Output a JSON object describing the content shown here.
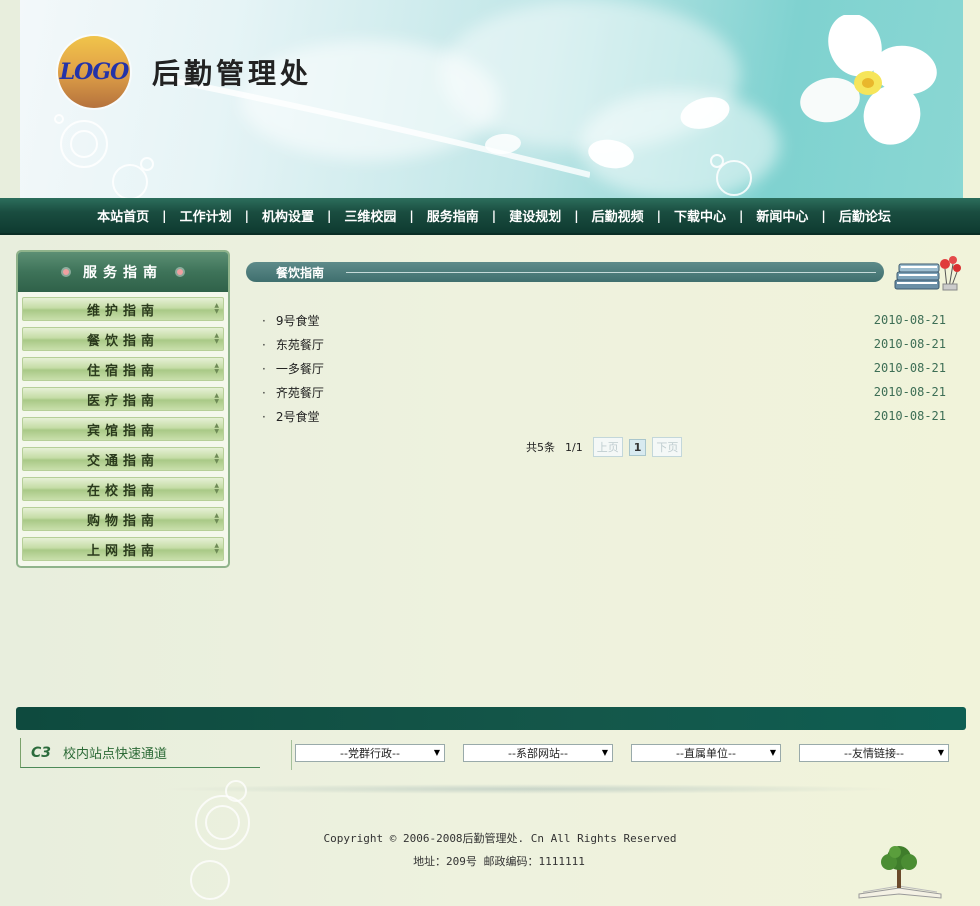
{
  "header": {
    "logo_text": "LOGO",
    "site_title": "后勤管理处"
  },
  "nav": {
    "items": [
      "本站首页",
      "工作计划",
      "机构设置",
      "三维校园",
      "服务指南",
      "建设规划",
      "后勤视频",
      "下载中心",
      "新闻中心",
      "后勤论坛"
    ],
    "separator": "|"
  },
  "sidebar": {
    "title": "服务指南",
    "items": [
      "维护指南",
      "餐饮指南",
      "住宿指南",
      "医疗指南",
      "宾馆指南",
      "交通指南",
      "在校指南",
      "购物指南",
      "上网指南"
    ]
  },
  "main": {
    "section_title": "餐饮指南",
    "articles": [
      {
        "title": "9号食堂",
        "date": "2010-08-21"
      },
      {
        "title": "东苑餐厅",
        "date": "2010-08-21"
      },
      {
        "title": "一多餐厅",
        "date": "2010-08-21"
      },
      {
        "title": "齐苑餐厅",
        "date": "2010-08-21"
      },
      {
        "title": "2号食堂",
        "date": "2010-08-21"
      }
    ],
    "pager": {
      "total": "共5条",
      "pages": "1/1",
      "prev": "上页",
      "current": "1",
      "next": "下页"
    }
  },
  "footer": {
    "quick_icon": "C3",
    "quick_label": "校内站点快速通道",
    "selects": [
      "--党群行政--",
      "--系部网站--",
      "--直属单位--",
      "--友情链接--"
    ],
    "copyright": "Copyright ©  2006-2008后勤管理处. Cn All Rights Reserved",
    "address": "地址：209号 邮政编码：1111111"
  },
  "colors": {
    "nav_bg": "#1a4d40",
    "accent_green": "#3e7359",
    "date_color": "#3d6e55",
    "header_teal": "#7fd2d0"
  }
}
